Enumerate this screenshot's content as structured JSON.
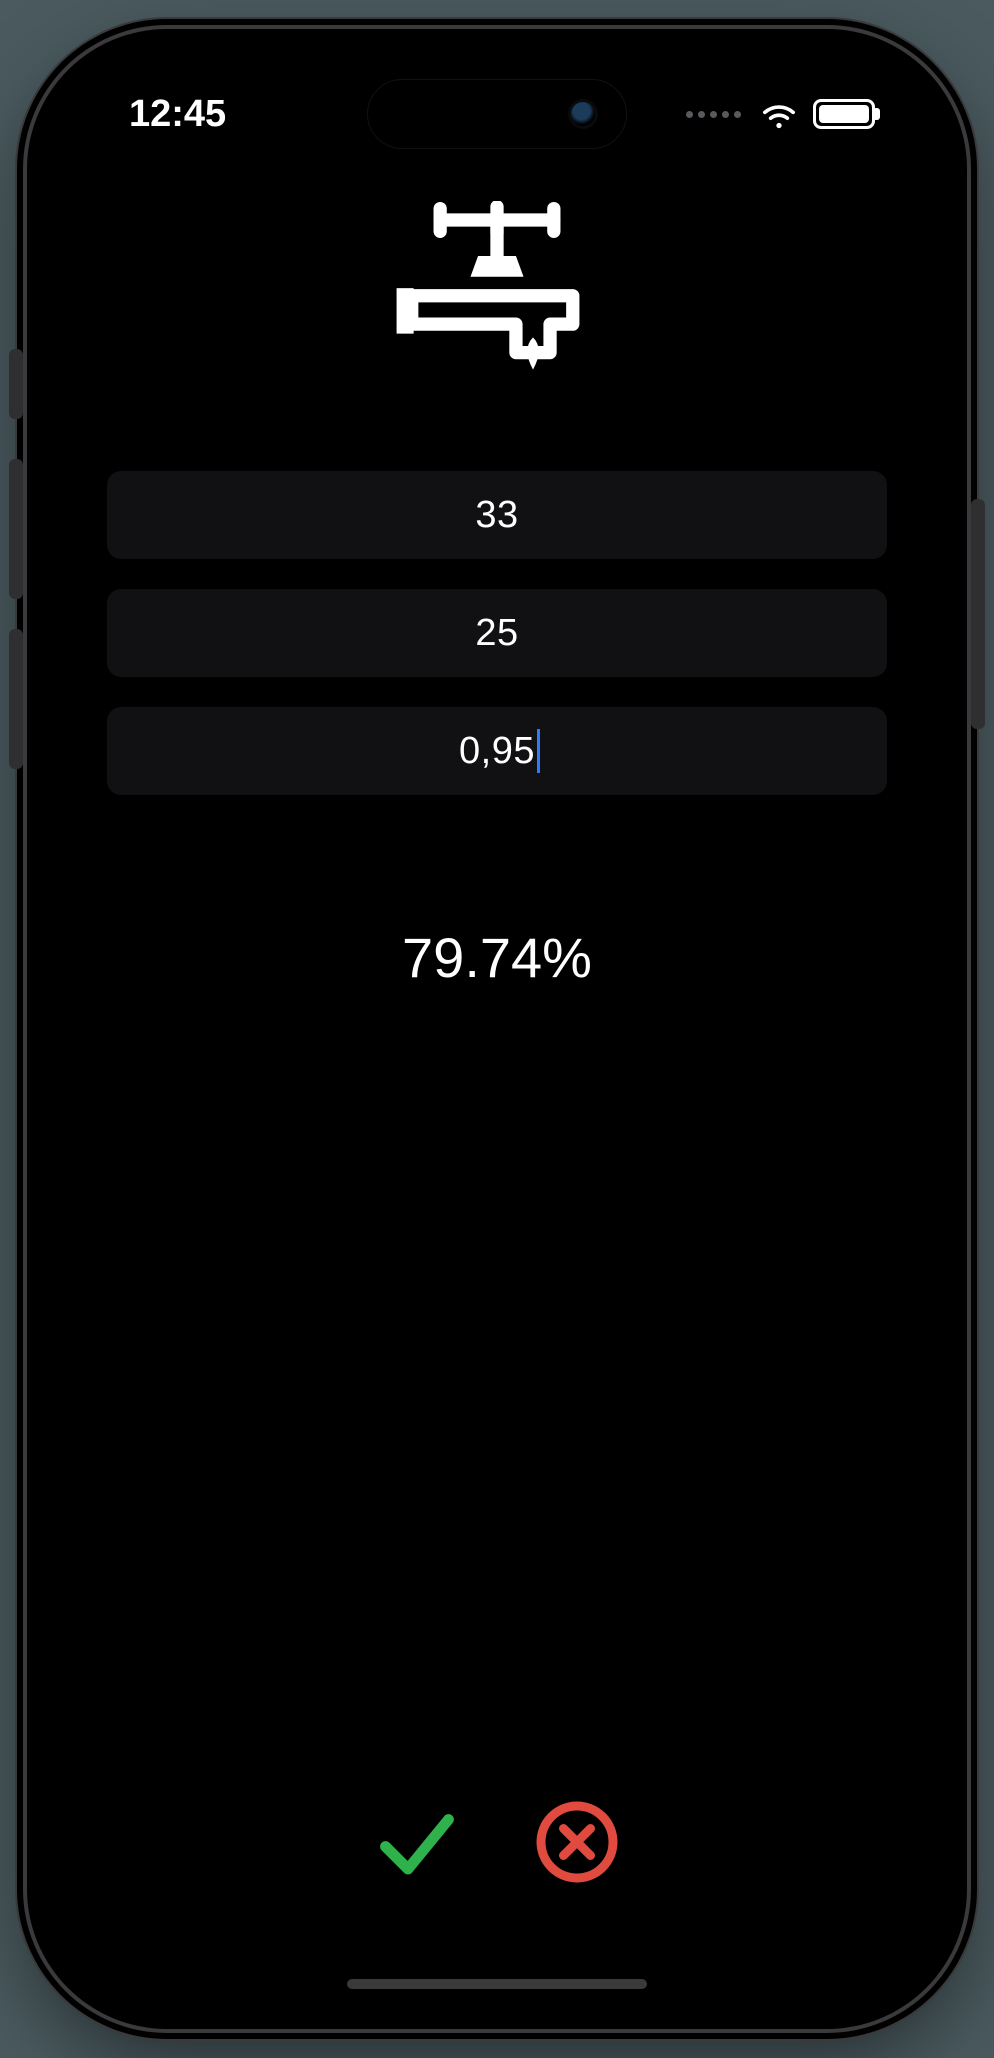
{
  "status": {
    "time": "12:45"
  },
  "inputs": {
    "field1": "33",
    "field2": "25",
    "field3": "0,95"
  },
  "result": "79.74%",
  "colors": {
    "confirm": "#2fb24c",
    "cancel": "#e04a3f"
  }
}
